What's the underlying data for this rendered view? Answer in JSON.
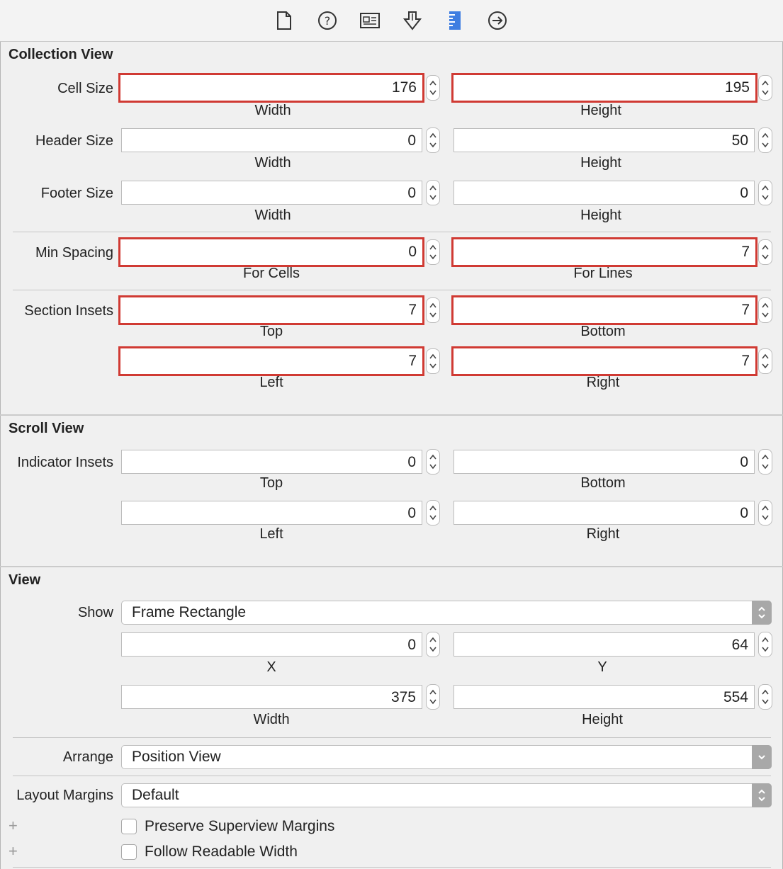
{
  "collection_view": {
    "title": "Collection View",
    "cell_size": {
      "label": "Cell Size",
      "width": "176",
      "height": "195",
      "width_label": "Width",
      "height_label": "Height"
    },
    "header_size": {
      "label": "Header Size",
      "width": "0",
      "height": "50",
      "width_label": "Width",
      "height_label": "Height"
    },
    "footer_size": {
      "label": "Footer Size",
      "width": "0",
      "height": "0",
      "width_label": "Width",
      "height_label": "Height"
    },
    "min_spacing": {
      "label": "Min Spacing",
      "cells": "0",
      "lines": "7",
      "cells_label": "For Cells",
      "lines_label": "For Lines"
    },
    "section_insets": {
      "label": "Section Insets",
      "top": "7",
      "bottom": "7",
      "left": "7",
      "right": "7",
      "top_label": "Top",
      "bottom_label": "Bottom",
      "left_label": "Left",
      "right_label": "Right"
    }
  },
  "scroll_view": {
    "title": "Scroll View",
    "indicator_insets": {
      "label": "Indicator Insets",
      "top": "0",
      "bottom": "0",
      "left": "0",
      "right": "0",
      "top_label": "Top",
      "bottom_label": "Bottom",
      "left_label": "Left",
      "right_label": "Right"
    }
  },
  "view": {
    "title": "View",
    "show": {
      "label": "Show",
      "value": "Frame Rectangle"
    },
    "frame": {
      "x": "0",
      "y": "64",
      "width": "375",
      "height": "554",
      "x_label": "X",
      "y_label": "Y",
      "width_label": "Width",
      "height_label": "Height"
    },
    "arrange": {
      "label": "Arrange",
      "value": "Position View"
    },
    "layout_margins": {
      "label": "Layout Margins",
      "value": "Default"
    },
    "preserve_superview_margins": {
      "label": "Preserve Superview Margins",
      "checked": false
    },
    "follow_readable_width": {
      "label": "Follow Readable Width",
      "checked": false
    }
  },
  "toolbar": {
    "icons": [
      "file-inspector-icon",
      "quick-help-icon",
      "identity-inspector-icon",
      "attributes-inspector-icon",
      "size-inspector-icon",
      "connections-inspector-icon"
    ],
    "selected": "size-inspector-icon",
    "accent": "#3f7ee1"
  },
  "colors": {
    "highlight": "#d03a33"
  }
}
